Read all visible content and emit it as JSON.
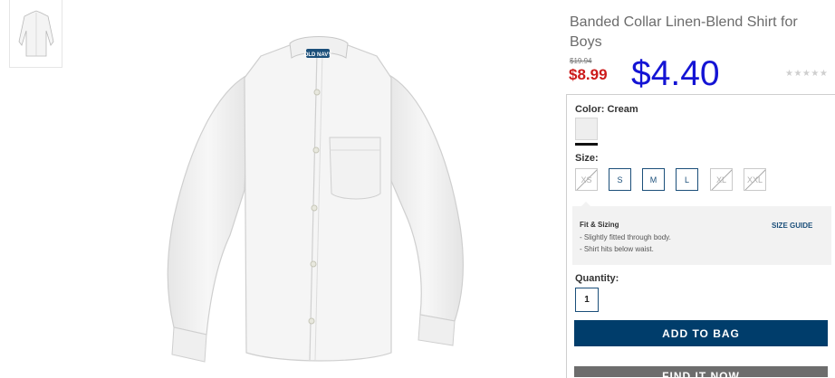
{
  "product": {
    "title": "Banded Collar Linen-Blend Shirt for Boys",
    "price_original": "$19.94",
    "price_sale": "$8.99",
    "price_overlay": "$4.40",
    "rating_stars": "★★★★★",
    "logo_text": "OLD NAVY"
  },
  "color": {
    "label": "Color:",
    "value": "Cream",
    "swatch_hex": "#eeeeee"
  },
  "size": {
    "label": "Size:",
    "options": [
      {
        "label": "XS",
        "available": false
      },
      {
        "label": "S",
        "available": true
      },
      {
        "label": "M",
        "available": true
      },
      {
        "label": "L",
        "available": true
      },
      {
        "label": "XL",
        "available": false
      },
      {
        "label": "XXL",
        "available": false
      }
    ]
  },
  "fit": {
    "title": "Fit & Sizing",
    "lines": [
      "- Slightly fitted through body.",
      "- Shirt hits below waist."
    ],
    "size_guide": "SIZE GUIDE"
  },
  "quantity": {
    "label": "Quantity:",
    "value": "1"
  },
  "actions": {
    "add_to_bag": "ADD TO BAG",
    "find_in_store": "FIND IT NOW"
  },
  "colors": {
    "sale_red": "#cc1a1a",
    "overlay_blue": "#1414d4",
    "accent_navy": "#003d6b"
  }
}
